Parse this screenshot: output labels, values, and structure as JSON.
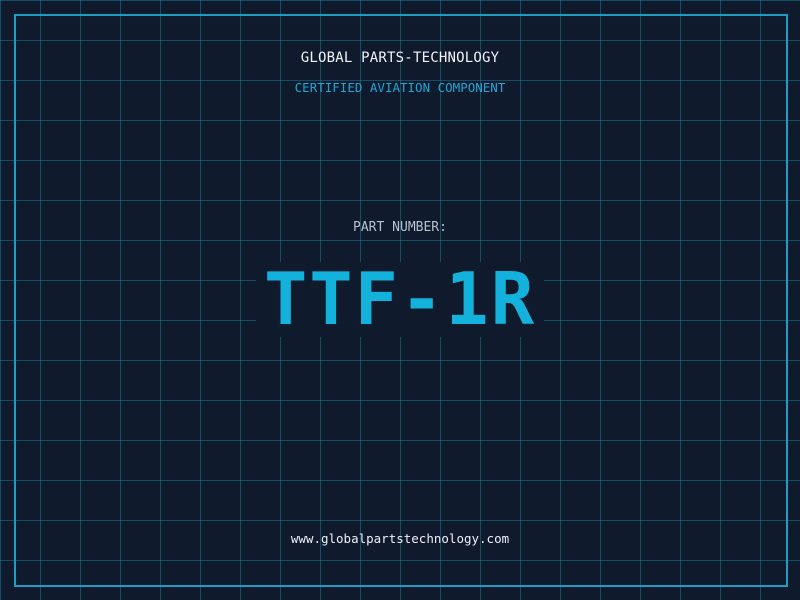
{
  "header": {
    "company": "GLOBAL PARTS-TECHNOLOGY",
    "subtitle": "CERTIFIED AVIATION COMPONENT"
  },
  "part": {
    "label": "PART NUMBER:",
    "number": "TTF-1R"
  },
  "footer": {
    "website": "www.globalpartstechnology.com"
  },
  "colors": {
    "background": "#0f1a2d",
    "grid": "#1696b9",
    "accent": "#12b2dc",
    "frame": "#1a9ec4"
  }
}
